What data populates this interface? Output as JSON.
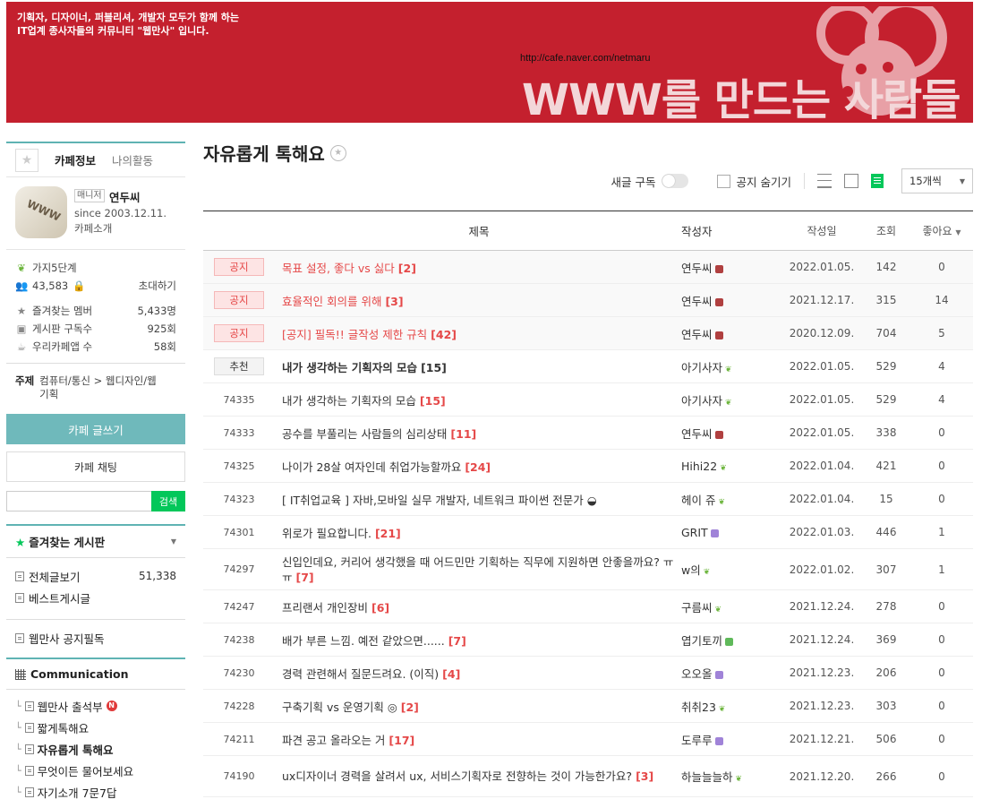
{
  "banner": {
    "desc_line1": "기획자, 디자이너, 퍼블리셔, 개발자 모두가 함께 하는",
    "desc_line2": "IT업계 종사자들의 커뮤니티 \"웹만사\" 입니다.",
    "url": "http://cafe.naver.com/netmaru",
    "headline": "WWW를 만드는 사람들"
  },
  "sidebar": {
    "tabs": [
      "카페정보",
      "나의활동"
    ],
    "manager_badge": "매니저",
    "manager_name": "연두씨",
    "since": "since 2003.12.11.",
    "intro": "카페소개",
    "avatar_text": "WWW",
    "level": "가지5단계",
    "members": "43,583",
    "invite": "초대하기",
    "stats": [
      {
        "label": "즐겨찾는 멤버",
        "value": "5,433명"
      },
      {
        "label": "게시판 구독수",
        "value": "925회"
      },
      {
        "label": "우리카페앱 수",
        "value": "58회"
      }
    ],
    "topic_label": "주제",
    "topic_value": "컴퓨터/통신 > 웹디자인/웹기획",
    "write_button": "카페 글쓰기",
    "chat_button": "카페 채팅",
    "search_button": "검색",
    "fav_board": "즐겨찾는 게시판",
    "menu": [
      {
        "label": "전체글보기",
        "count": "51,338"
      },
      {
        "label": "베스트게시글",
        "count": ""
      }
    ],
    "notice_board": "웹만사 공지필독",
    "group": "Communication",
    "sub": [
      {
        "label": "웹만사 출석부",
        "new": "N"
      },
      {
        "label": "짧게톡해요",
        "new": ""
      },
      {
        "label": "자유롭게 톡해요",
        "new": ""
      },
      {
        "label": "무엇이든 물어보세요",
        "new": ""
      },
      {
        "label": "자기소개 7문7답",
        "new": ""
      }
    ]
  },
  "main": {
    "board_title": "자유롭게 톡해요",
    "subscribe": "새글 구독",
    "hide_notice": "공지 숨기기",
    "per_page": "15개씩",
    "columns": {
      "title": "제목",
      "author": "작성자",
      "date": "작성일",
      "views": "조회",
      "likes": "좋아요"
    },
    "rows": [
      {
        "no": "공지",
        "title": "목표 설정, 좋다 vs 싫다",
        "cmt": "[2]",
        "author": "연두씨",
        "date": "2022.01.05.",
        "views": "142",
        "likes": "0"
      },
      {
        "no": "공지",
        "title": "효율적인 회의를 위해",
        "cmt": "[3]",
        "author": "연두씨",
        "date": "2021.12.17.",
        "views": "315",
        "likes": "14"
      },
      {
        "no": "공지",
        "title": "[공지] 필독!! 글작성 제한 규칙",
        "cmt": "[42]",
        "author": "연두씨",
        "date": "2020.12.09.",
        "views": "704",
        "likes": "5"
      },
      {
        "no": "추천",
        "title": "내가 생각하는 기획자의 모습",
        "cmt": "[15]",
        "author": "아기사자",
        "date": "2022.01.05.",
        "views": "529",
        "likes": "4"
      },
      {
        "no": "74335",
        "title": "내가 생각하는 기획자의 모습",
        "cmt": "[15]",
        "author": "아기사자",
        "date": "2022.01.05.",
        "views": "529",
        "likes": "4"
      },
      {
        "no": "74333",
        "title": "공수를 부풀리는 사람들의 심리상태",
        "cmt": "[11]",
        "author": "연두씨",
        "date": "2022.01.05.",
        "views": "338",
        "likes": "0"
      },
      {
        "no": "74325",
        "title": "나이가 28살 여자인데 취업가능할까요",
        "cmt": "[24]",
        "author": "Hihi22",
        "date": "2022.01.04.",
        "views": "421",
        "likes": "0"
      },
      {
        "no": "74323",
        "title": "[ IT취업교육 ] 자바,모바일 실무 개발자, 네트워크 파이썬 전문가 ◒",
        "cmt": "",
        "author": "헤이 쥬",
        "date": "2022.01.04.",
        "views": "15",
        "likes": "0"
      },
      {
        "no": "74301",
        "title": "위로가 필요합니다.",
        "cmt": "[21]",
        "author": "GRIT",
        "date": "2022.01.03.",
        "views": "446",
        "likes": "1"
      },
      {
        "no": "74297",
        "title": "신입인데요, 커리어 생각했을 때 어드민만 기획하는 직무에 지원하면 안좋을까요? ㅠㅠ",
        "cmt": "[7]",
        "author": "w의",
        "date": "2022.01.02.",
        "views": "307",
        "likes": "1"
      },
      {
        "no": "74247",
        "title": "프리랜서 개인장비",
        "cmt": "[6]",
        "author": "구름씨",
        "date": "2021.12.24.",
        "views": "278",
        "likes": "0"
      },
      {
        "no": "74238",
        "title": "배가 부른 느낌. 예전 같았으면......",
        "cmt": "[7]",
        "author": "엽기토끼",
        "date": "2021.12.24.",
        "views": "369",
        "likes": "0"
      },
      {
        "no": "74230",
        "title": "경력 관련해서 질문드려요. (이직)",
        "cmt": "[4]",
        "author": "오오올",
        "date": "2021.12.23.",
        "views": "206",
        "likes": "0"
      },
      {
        "no": "74228",
        "title": "구축기획 vs 운영기획 ◎",
        "cmt": "[2]",
        "author": "취취23",
        "date": "2021.12.23.",
        "views": "303",
        "likes": "0"
      },
      {
        "no": "74211",
        "title": "파견 공고 올라오는 거",
        "cmt": "[17]",
        "author": "도루루",
        "date": "2021.12.21.",
        "views": "506",
        "likes": "0"
      },
      {
        "no": "74190",
        "title": "ux디자이너 경력을 살려서 ux, 서비스기획자로 전향하는 것이 가능한가요?",
        "cmt": "[3]",
        "author": "하늘늘늘하",
        "date": "2021.12.20.",
        "views": "266",
        "likes": "0"
      }
    ]
  },
  "colors": {
    "banner": "#c4202e",
    "accent": "#5fb3b3",
    "green": "#03c75a",
    "notice": "#e54848"
  }
}
